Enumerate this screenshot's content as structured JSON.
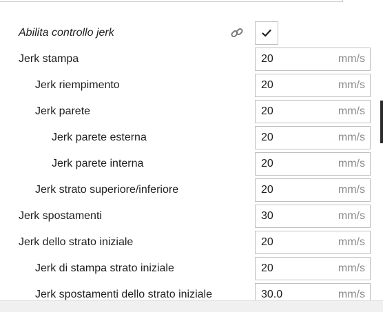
{
  "settings": {
    "enable_jerk": {
      "label": "Abilita controllo jerk",
      "checked": true
    },
    "rows": [
      {
        "label": "Jerk stampa",
        "value": "20",
        "unit": "mm/s"
      },
      {
        "label": "Jerk riempimento",
        "value": "20",
        "unit": "mm/s"
      },
      {
        "label": "Jerk parete",
        "value": "20",
        "unit": "mm/s"
      },
      {
        "label": "Jerk parete esterna",
        "value": "20",
        "unit": "mm/s"
      },
      {
        "label": "Jerk parete interna",
        "value": "20",
        "unit": "mm/s"
      },
      {
        "label": "Jerk strato superiore/inferiore",
        "value": "20",
        "unit": "mm/s"
      },
      {
        "label": "Jerk spostamenti",
        "value": "30",
        "unit": "mm/s"
      },
      {
        "label": "Jerk dello strato iniziale",
        "value": "20",
        "unit": "mm/s"
      },
      {
        "label": "Jerk di stampa strato iniziale",
        "value": "20",
        "unit": "mm/s"
      },
      {
        "label": "Jerk spostamenti dello strato iniziale",
        "value": "30.0",
        "unit": "mm/s"
      }
    ]
  },
  "icons": {
    "link": "link-icon",
    "check": "check-icon"
  }
}
